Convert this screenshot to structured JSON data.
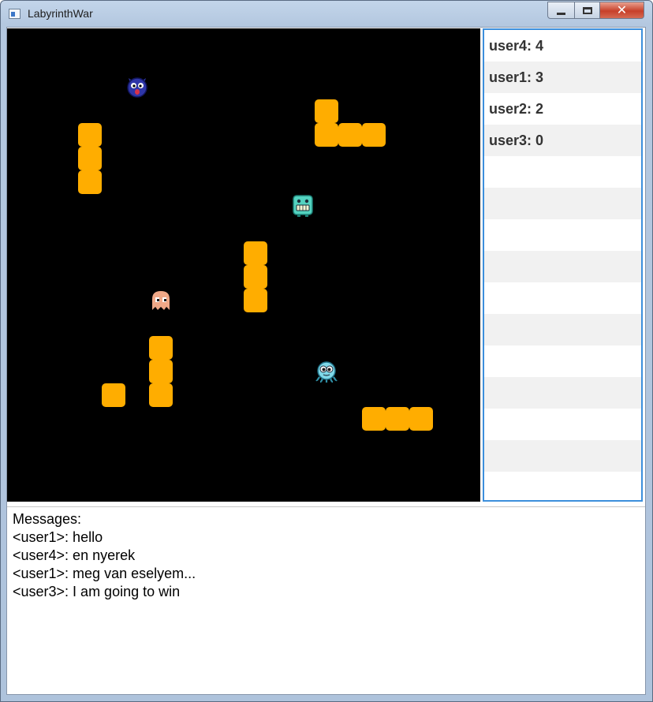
{
  "window": {
    "title": "LabyrinthWar"
  },
  "controls": {
    "close_glyph": "✕"
  },
  "colors": {
    "board": "#000000",
    "wall": "#ffad00",
    "score_border": "#3c8fdc"
  },
  "scoreboard": [
    {
      "label": "user4: 4"
    },
    {
      "label": "user1: 3"
    },
    {
      "label": "user2: 2"
    },
    {
      "label": "user3: 0"
    },
    {
      "label": ""
    },
    {
      "label": ""
    },
    {
      "label": ""
    },
    {
      "label": ""
    },
    {
      "label": ""
    },
    {
      "label": ""
    },
    {
      "label": ""
    },
    {
      "label": ""
    },
    {
      "label": ""
    },
    {
      "label": ""
    },
    {
      "label": ""
    }
  ],
  "messages": {
    "heading": "Messages:",
    "lines": [
      "<user1>: hello",
      "<user4>: en nyerek",
      "<user1>: meg van eselyem...",
      "<user3>: I am going to win"
    ]
  },
  "board": {
    "characters": [
      {
        "icon": "blue-monster-icon"
      },
      {
        "icon": "green-monster-icon"
      },
      {
        "icon": "ghost-icon"
      },
      {
        "icon": "octopus-monster-icon"
      }
    ]
  }
}
